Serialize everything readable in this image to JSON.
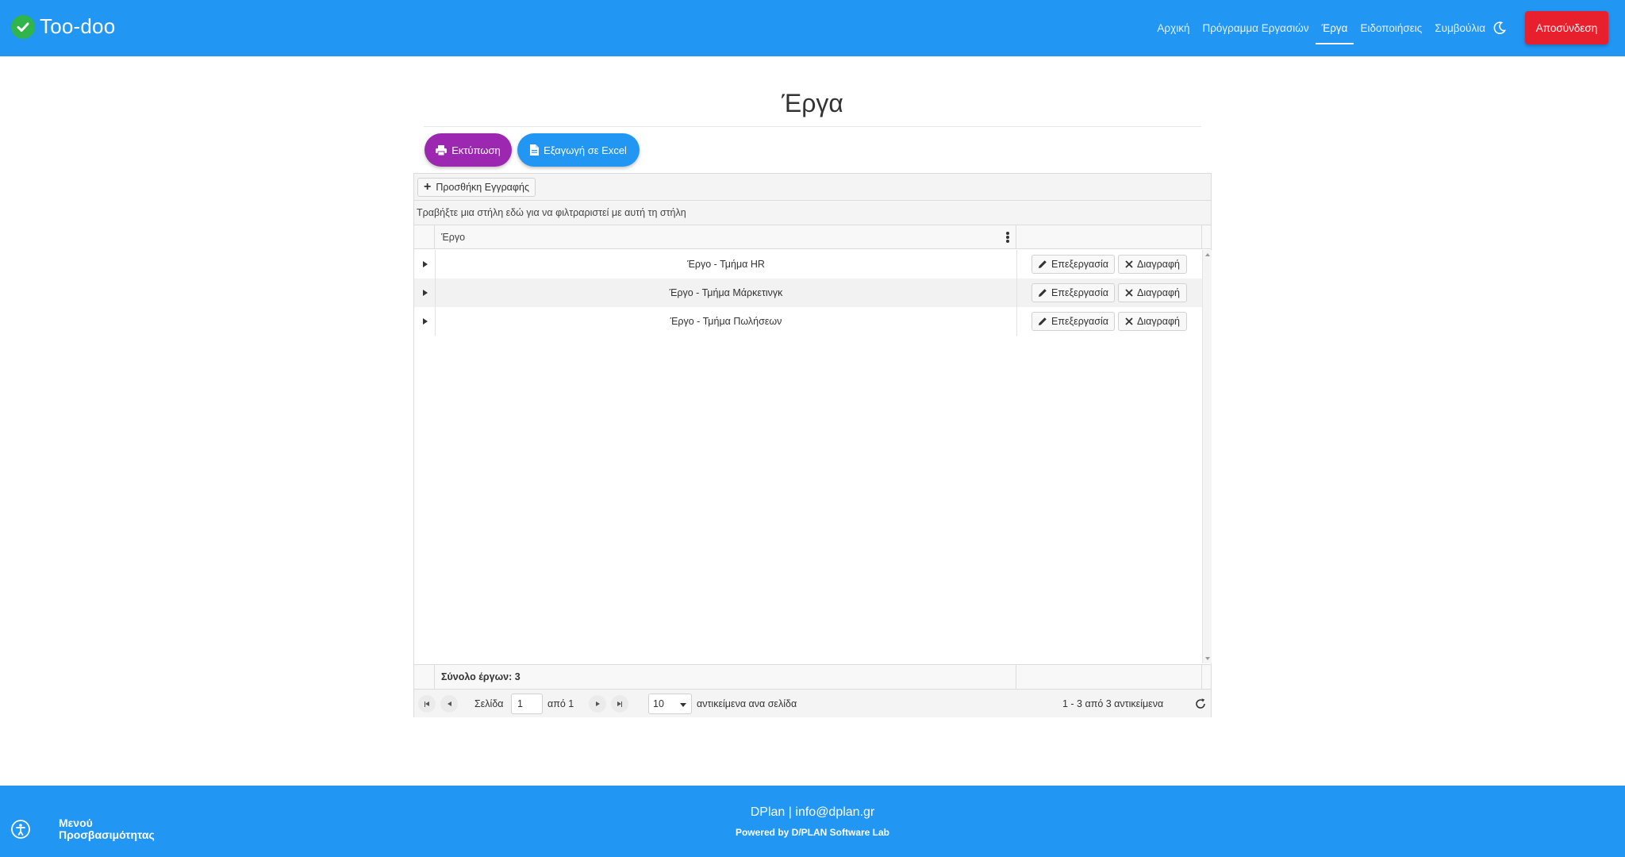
{
  "app": {
    "name": "Too-doo"
  },
  "colors": {
    "primary": "#2196f3",
    "logout": "#e8202e",
    "print": "#9c27b0",
    "check": "#2fb54a"
  },
  "nav": {
    "items": [
      {
        "label": "Αρχική"
      },
      {
        "label": "Πρόγραμμα Εργασιών"
      },
      {
        "label": "Έργα",
        "active": true
      },
      {
        "label": "Ειδοποιήσεις"
      },
      {
        "label": "Συμβούλια"
      }
    ],
    "logout_label": "Αποσύνδεση",
    "theme_icon": "moon-icon"
  },
  "page": {
    "title": "Έργα"
  },
  "actions": {
    "print_label": "Εκτύπωση",
    "excel_label": "Εξαγωγή σε Excel"
  },
  "grid": {
    "add_label": "Προσθήκη Εγγραφής",
    "group_hint": "Τραβήξτε μια στήλη εδώ για να φιλτραριστεί με αυτή τη στήλη",
    "column_header": "Έργο",
    "rows": [
      {
        "name": "Έργο - Τμήμα HR"
      },
      {
        "name": "Έργο - Τμήμα Μάρκετινγκ"
      },
      {
        "name": "Έργο - Τμήμα Πωλήσεων"
      }
    ],
    "edit_label": "Επεξεργασία",
    "delete_label": "Διαγραφή",
    "summary": "Σύνολο έργων: 3",
    "pager": {
      "page_label": "Σελίδα",
      "page_value": "1",
      "of_label": "από 1",
      "page_size": "10",
      "per_page_label": "αντικείμενα ανα σελίδα",
      "range_label": "1 - 3 από 3 αντικείμενα"
    }
  },
  "footer": {
    "company": "DPlan",
    "email": "info@dplan.gr",
    "powered": "Powered by D/PLAN Software Lab",
    "accessibility_label_line1": "Μενού",
    "accessibility_label_line2": "Προσβασιμότητας"
  }
}
